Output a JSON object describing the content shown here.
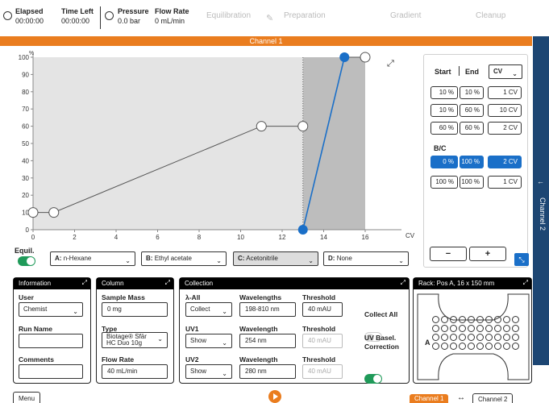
{
  "header": {
    "elapsed_label": "Elapsed",
    "elapsed_value": "00:00:00",
    "timeleft_label": "Time Left",
    "timeleft_value": "00:00:00",
    "pressure_label": "Pressure",
    "pressure_value": "0.0 bar",
    "flow_label": "Flow Rate",
    "flow_value": "0 mL/min",
    "stages": [
      "Equilibration",
      "Preparation",
      "Gradient",
      "Cleanup"
    ]
  },
  "channel_bar": "Channel 1",
  "side_tab": "Channel 2",
  "chart_data": {
    "type": "line",
    "y_unit": "%",
    "x_unit": "CV",
    "xlim": [
      0,
      19
    ],
    "ylim": [
      0,
      100
    ],
    "xticks": [
      0,
      2,
      4,
      6,
      8,
      10,
      12,
      14,
      16
    ],
    "yticks": [
      0,
      10,
      20,
      30,
      40,
      50,
      60,
      70,
      80,
      90,
      100
    ],
    "series": [
      {
        "points": [
          [
            0,
            10
          ],
          [
            1,
            10
          ],
          [
            11,
            60
          ],
          [
            13,
            60
          ]
        ],
        "style": "gray-line-white-markers"
      },
      {
        "points": [
          [
            13,
            0
          ],
          [
            15,
            100
          ]
        ],
        "style": "blue-line"
      },
      {
        "points": [
          [
            15,
            100
          ],
          [
            16,
            100
          ]
        ],
        "style": "gray-line"
      }
    ],
    "shaded_regions": [
      [
        0,
        13,
        "light"
      ],
      [
        13,
        16,
        "dark"
      ]
    ],
    "dotted_x": 13
  },
  "equil_label": "Equil.",
  "solvents": [
    {
      "key": "A:",
      "name": "n-Hexane"
    },
    {
      "key": "B:",
      "name": "Ethyl acetate"
    },
    {
      "key": "C:",
      "name": "Acetonitrile"
    },
    {
      "key": "D:",
      "name": "None"
    }
  ],
  "gradient_table": {
    "start_label": "Start",
    "end_label": "End",
    "unit_select": "CV",
    "rows": [
      [
        "10 %",
        "10 %",
        "1 CV"
      ],
      [
        "10 %",
        "60 %",
        "10 CV"
      ],
      [
        "60 %",
        "60 %",
        "2 CV"
      ]
    ],
    "bc_label": "B/C",
    "bc_rows": [
      [
        "0 %",
        "100 %",
        "2 CV"
      ],
      [
        "100 %",
        "100 %",
        "1 CV"
      ]
    ],
    "minus": "−",
    "plus": "+"
  },
  "info": {
    "title": "Information",
    "user_label": "User",
    "user_value": "Chemist",
    "runname_label": "Run Name",
    "comments_label": "Comments"
  },
  "column": {
    "title": "Column",
    "mass_label": "Sample Mass",
    "mass_value": "0 mg",
    "type_label": "Type",
    "type_value1": "Biotage® Sfär",
    "type_value2": "HC Duo 10g",
    "flow_label": "Flow Rate",
    "flow_value": "40 mL/min"
  },
  "collection": {
    "title": "Collection",
    "lall_label": "λ-All",
    "lall_value": "Collect",
    "wavelengths_label": "Wavelengths",
    "wavelengths_value": "198-810 nm",
    "threshold_label": "Threshold",
    "threshold1": "40 mAU",
    "uv1_label": "UV1",
    "uv1_value": "Show",
    "wavelength_label": "Wavelength",
    "wavelength1": "254 nm",
    "threshold2": "40 mAU",
    "uv2_label": "UV2",
    "uv2_value": "Show",
    "wavelength2": "280 nm",
    "threshold3": "40 mAU",
    "collect_all_label": "Collect All",
    "uv_corr_label1": "UV Basel.",
    "uv_corr_label2": "Correction"
  },
  "rack": {
    "title": "Rack: Pos A, 16 x 150 mm",
    "pos_label": "A"
  },
  "footer": {
    "menu": "Menu",
    "ch1": "Channel 1",
    "swap": "↔",
    "ch2": "Channel 2"
  }
}
